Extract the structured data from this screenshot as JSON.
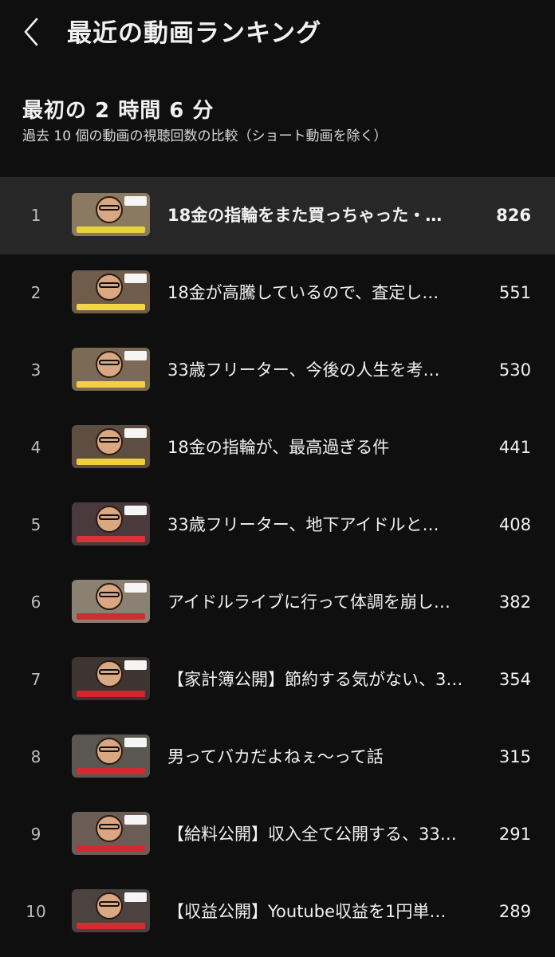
{
  "header": {
    "title": "最近の動画ランキング",
    "back_icon": "chevron-left-icon"
  },
  "section": {
    "title": "最初の 2 時間 6 分",
    "subtitle": "過去 10 個の動画の視聴回数の比較（ショート動画を除く）"
  },
  "colors": {
    "background": "#0f0f0f",
    "highlight_row": "#272727",
    "text": "#f1f1f1",
    "rank_text": "#bcbcbc"
  },
  "videos": [
    {
      "rank": "1",
      "title": "18金の指輪をまた買っちゃった・…",
      "views": "826",
      "thumb_bg": "#8a7a62",
      "band": "#e8d23a"
    },
    {
      "rank": "2",
      "title": "18金が高騰しているので、査定し…",
      "views": "551",
      "thumb_bg": "#6f5c4a",
      "band": "#f2d64a"
    },
    {
      "rank": "3",
      "title": "33歳フリーター、今後の人生を考…",
      "views": "530",
      "thumb_bg": "#7b6a56",
      "band": "#f4d142"
    },
    {
      "rank": "4",
      "title": "18金の指輪が、最高過ぎる件",
      "views": "441",
      "thumb_bg": "#5e4e42",
      "band": "#f0cf3c"
    },
    {
      "rank": "5",
      "title": "33歳フリーター、地下アイドルと…",
      "views": "408",
      "thumb_bg": "#4a3a3e",
      "band": "#d8343a"
    },
    {
      "rank": "6",
      "title": "アイドルライブに行って体調を崩し…",
      "views": "382",
      "thumb_bg": "#8b8172",
      "band": "#c93036"
    },
    {
      "rank": "7",
      "title": "【家計簿公開】節約する気がない、3…",
      "views": "354",
      "thumb_bg": "#3e3532",
      "band": "#d4242c"
    },
    {
      "rank": "8",
      "title": "男ってバカだよねぇ〜って話",
      "views": "315",
      "thumb_bg": "#5a5650",
      "band": "#cf2d33"
    },
    {
      "rank": "9",
      "title": "【給料公開】収入全て公開する、33…",
      "views": "291",
      "thumb_bg": "#6b5d55",
      "band": "#d22a30"
    },
    {
      "rank": "10",
      "title": "【収益公開】Youtube収益を1円単…",
      "views": "289",
      "thumb_bg": "#4c4240",
      "band": "#d62b31"
    }
  ]
}
